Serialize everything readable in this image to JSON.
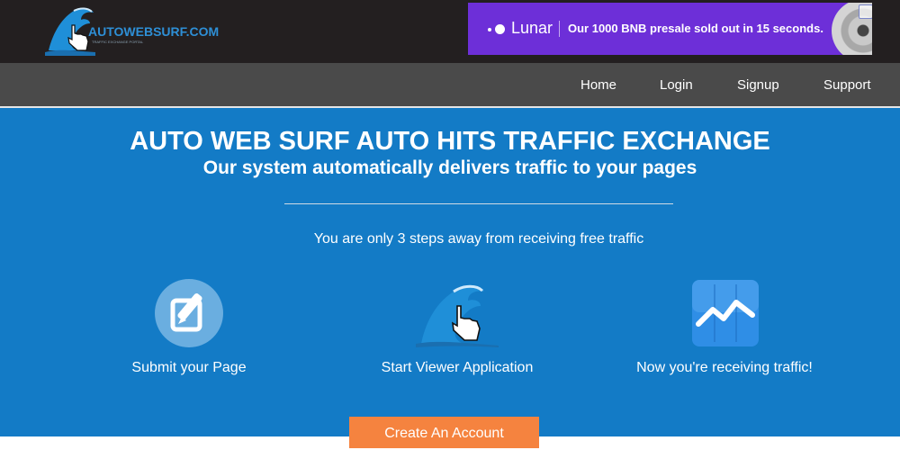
{
  "header": {
    "logo_text": "AUTOWEBSURF.COM",
    "logo_tagline": "TRAFFIC EXCHANGE PORTAL"
  },
  "ad": {
    "brand": "Lunar",
    "text": "Our 1000 BNB presale sold out in 15 seconds.",
    "accent_color": "#6d2fd8"
  },
  "nav": {
    "items": [
      {
        "label": "Home"
      },
      {
        "label": "Login"
      },
      {
        "label": "Signup"
      },
      {
        "label": "Support"
      }
    ]
  },
  "hero": {
    "title": "AUTO WEB SURF AUTO HITS TRAFFIC EXCHANGE",
    "subtitle": "Our system automatically delivers traffic to your pages",
    "steps_text": "You are only 3 steps away from receiving free traffic",
    "background_color": "#137bc6",
    "steps": [
      {
        "label": "Submit your Page",
        "icon": "edit-icon"
      },
      {
        "label": "Start Viewer Application",
        "icon": "wave-cursor-icon"
      },
      {
        "label": "Now you're receiving traffic!",
        "icon": "chart-icon"
      }
    ]
  },
  "cta": {
    "label": "Create An Account",
    "color": "#f5833f"
  }
}
